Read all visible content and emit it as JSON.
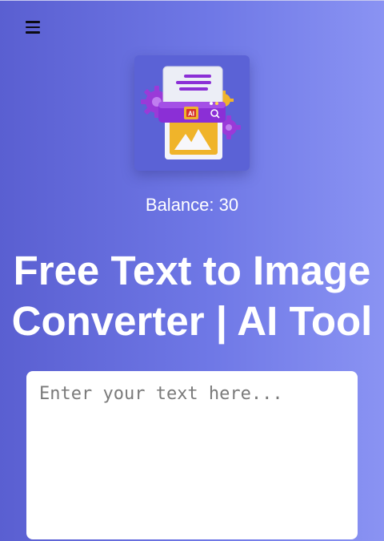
{
  "header": {
    "menu_icon": "hamburger-menu-icon"
  },
  "logo": {
    "icon": "ai-text-to-image-logo",
    "badge_text": "AI"
  },
  "balance": {
    "text": "Balance: 30"
  },
  "main": {
    "title": "Free Text to Image Converter | AI Tool"
  },
  "prompt": {
    "placeholder": "Enter your text here...",
    "value": ""
  },
  "colors": {
    "background_start": "#5a5fd1",
    "background_end": "#8a93f3",
    "accent_purple": "#8b2fd6",
    "accent_yellow": "#f0b42a"
  }
}
